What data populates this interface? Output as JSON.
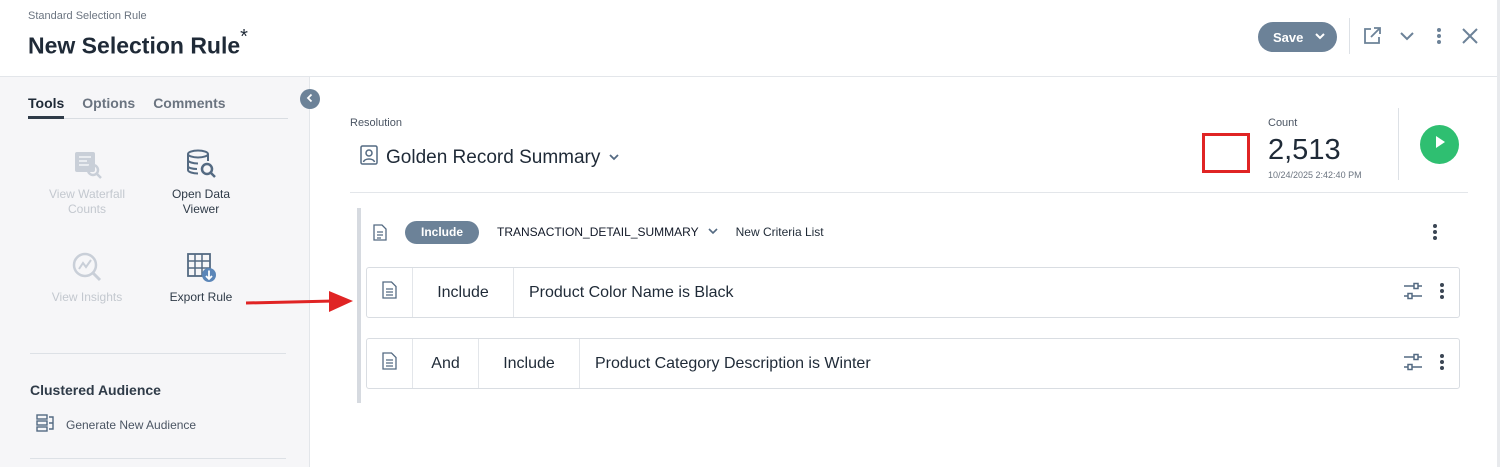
{
  "header": {
    "subtitle": "Standard Selection Rule",
    "title": "New Selection Rule",
    "modified_marker": "*",
    "save_label": "Save"
  },
  "sidebar": {
    "tabs": [
      {
        "label": "Tools",
        "active": true
      },
      {
        "label": "Options",
        "active": false
      },
      {
        "label": "Comments",
        "active": false
      }
    ],
    "tools": [
      {
        "line1": "View Waterfall",
        "line2": "Counts",
        "enabled": false,
        "icon": "waterfall-search-icon"
      },
      {
        "line1": "Open Data",
        "line2": "Viewer",
        "enabled": true,
        "icon": "database-search-icon"
      },
      {
        "line1": "View Insights",
        "line2": "",
        "enabled": false,
        "icon": "insights-chart-icon"
      },
      {
        "line1": "Export Rule",
        "line2": "",
        "enabled": true,
        "icon": "table-export-icon"
      }
    ],
    "section_title": "Clustered Audience",
    "generate_label": "Generate New Audience"
  },
  "main": {
    "resolution_label": "Resolution",
    "resolution_value": "Golden Record Summary",
    "count_label": "Count",
    "count_value": "2,513",
    "count_date": "10/24/2025 2:42:40 PM",
    "group": {
      "include_label": "Include",
      "table_name": "TRANSACTION_DETAIL_SUMMARY",
      "criteria_list_label": "New Criteria List"
    },
    "criteria": [
      {
        "connector": "",
        "mode": "Include",
        "text": "Product Color Name is Black"
      },
      {
        "connector": "And",
        "mode": "Include",
        "text": "Product Category Description is Winter"
      }
    ]
  },
  "colors": {
    "accent": "#6c8298",
    "run": "#2fbf71",
    "highlight": "#e02424"
  }
}
